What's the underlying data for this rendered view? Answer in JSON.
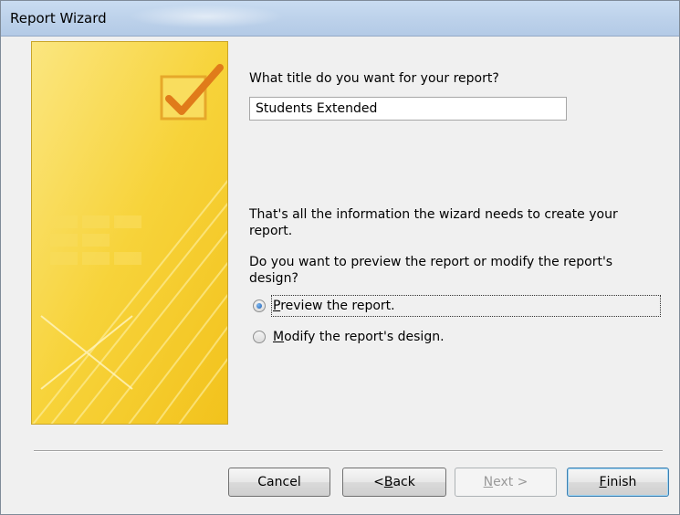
{
  "window": {
    "title": "Report Wizard"
  },
  "title_prompt": "What title do you want for your report?",
  "title_value": "Students Extended",
  "info_text_line1": "That's all the information the wizard needs to create your",
  "info_text_line2": "report.",
  "question_line1": "Do you want to preview the report or modify the report's",
  "question_line2": "design?",
  "options": [
    {
      "prefix": "",
      "access_key": "P",
      "rest": "review the report.",
      "checked": true
    },
    {
      "prefix": "",
      "access_key": "M",
      "rest": "odify the report's design.",
      "checked": false
    }
  ],
  "buttons": {
    "cancel": "Cancel",
    "back_prefix": "< ",
    "back_key": "B",
    "back_rest": "ack",
    "next_key": "N",
    "next_rest": "ext >",
    "finish_key": "F",
    "finish_rest": "inish"
  },
  "colors": {
    "panel_yellow": "#f7d33a",
    "checkmark": "#e07b1a",
    "accent_blue": "#1f5fb4"
  }
}
